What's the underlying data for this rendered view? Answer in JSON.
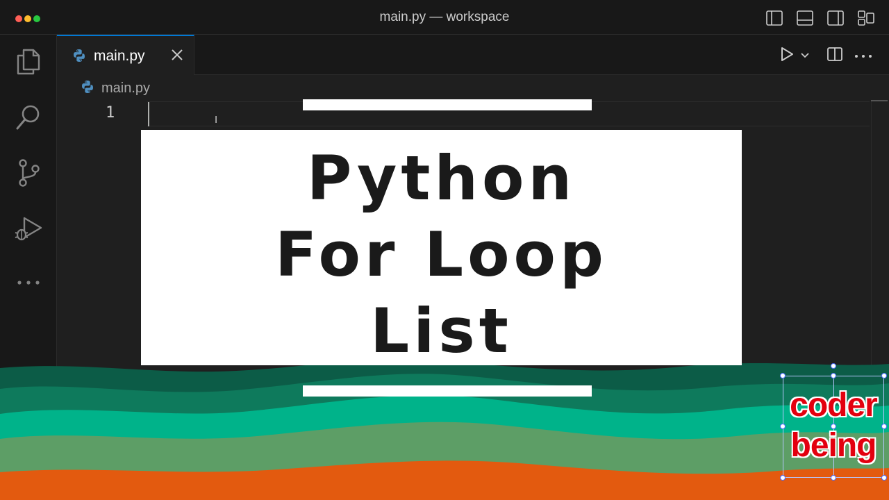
{
  "window": {
    "title": "main.py — workspace",
    "layout_controls": [
      "toggle-primary-sidebar-icon",
      "toggle-panel-icon",
      "toggle-secondary-sidebar-icon",
      "customize-layout-icon"
    ]
  },
  "activity_bar": {
    "items": [
      "explorer-icon",
      "search-icon",
      "source-control-icon",
      "run-and-debug-icon",
      "more-icon"
    ]
  },
  "tab": {
    "label": "main.py",
    "icon": "python-icon",
    "close": "close-icon"
  },
  "editor_actions": [
    "run-icon",
    "chevron-down-icon",
    "split-editor-icon",
    "more-actions-icon"
  ],
  "breadcrumb": {
    "label": "main.py"
  },
  "editor": {
    "line_number": "1"
  },
  "overlay": {
    "line1": "Python",
    "line2": "For Loop",
    "line3": "List"
  },
  "logo": {
    "line1": "coder",
    "line2": "being"
  },
  "colors": {
    "accent": "#0078d4",
    "wave_dark": "#0c5c47",
    "wave_mid": "#0e7a5c",
    "wave_teal": "#00b38a",
    "wave_sage": "#5d9e66",
    "wave_orange": "#e35a0f",
    "logo_red": "#e3000f"
  }
}
